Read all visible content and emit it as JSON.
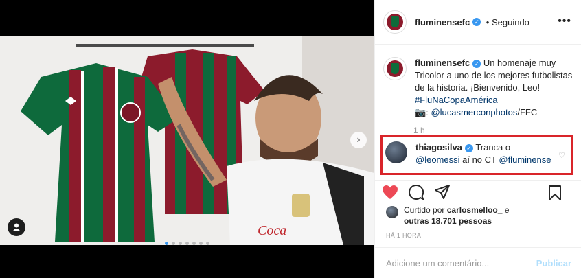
{
  "post": {
    "username": "fluminensefc",
    "follow_status": "Seguindo",
    "more_label": "•••",
    "caption": {
      "text": "Un homenaje muy Tricolor a uno de los mejores futbolistas de la historia. ¡Bienvenido, Leo!",
      "hashtag": "#FluNaCopaAmérica",
      "camera_glyph": "📷:",
      "credit_handle": "@lucasmerconphotos",
      "credit_suffix": "/FFC"
    },
    "time": "1 h"
  },
  "comment": {
    "username": "thiagosilva",
    "text_a": "Tranca o",
    "mention_1": "@leomessi",
    "text_b": "aí no CT",
    "mention_2": "@fluminense"
  },
  "likes": {
    "prefix": "Curtido por",
    "user": "carlosmelloo_",
    "suffix_a": "e",
    "suffix_b": "outras 18.701 pessoas"
  },
  "timestamp": "HÁ 1 HORA",
  "add_comment": {
    "placeholder": "Adicione um comentário...",
    "publish_label": "Publicar"
  },
  "colors": {
    "like_red": "#ed4956",
    "verified_blue": "#3897f0",
    "highlight_red": "#d9252a",
    "link": "#00376b"
  },
  "carousel": {
    "slides": 7,
    "active": 1
  }
}
